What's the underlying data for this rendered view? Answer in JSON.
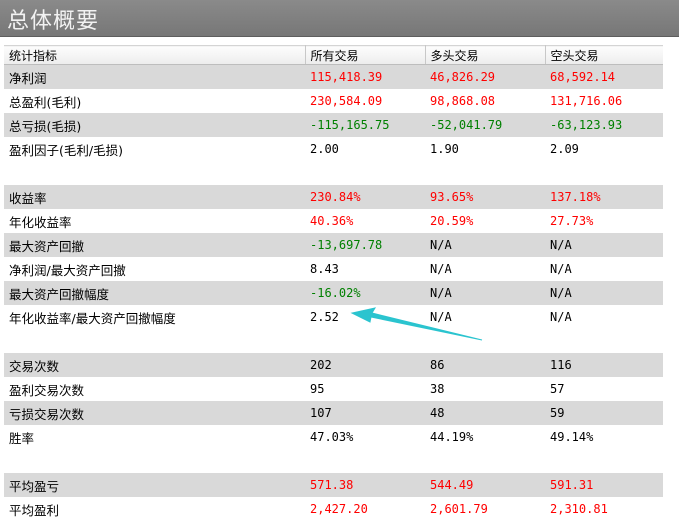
{
  "window": {
    "title": "总体概要"
  },
  "table": {
    "headers": [
      "统计指标",
      "所有交易",
      "多头交易",
      "空头交易"
    ],
    "rows": [
      {
        "label": "净利润",
        "values": [
          "115,418.39",
          "46,826.29",
          "68,592.14"
        ],
        "colors": [
          "red",
          "red",
          "red"
        ],
        "shaded": true
      },
      {
        "label": "总盈利(毛利)",
        "values": [
          "230,584.09",
          "98,868.08",
          "131,716.06"
        ],
        "colors": [
          "red",
          "red",
          "red"
        ],
        "shaded": false
      },
      {
        "label": "总亏损(毛损)",
        "values": [
          "-115,165.75",
          "-52,041.79",
          "-63,123.93"
        ],
        "colors": [
          "green",
          "green",
          "green"
        ],
        "shaded": true
      },
      {
        "label": "盈利因子(毛利/毛损)",
        "values": [
          "2.00",
          "1.90",
          "2.09"
        ],
        "colors": [
          "black",
          "black",
          "black"
        ],
        "shaded": false
      },
      {
        "spacer": true,
        "shaded": false
      },
      {
        "label": "收益率",
        "values": [
          "230.84%",
          "93.65%",
          "137.18%"
        ],
        "colors": [
          "red",
          "red",
          "red"
        ],
        "shaded": true
      },
      {
        "label": "年化收益率",
        "values": [
          "40.36%",
          "20.59%",
          "27.73%"
        ],
        "colors": [
          "red",
          "red",
          "red"
        ],
        "shaded": false
      },
      {
        "label": "最大资产回撤",
        "values": [
          "-13,697.78",
          "N/A",
          "N/A"
        ],
        "colors": [
          "green",
          "black",
          "black"
        ],
        "shaded": true
      },
      {
        "label": "净利润/最大资产回撤",
        "values": [
          "8.43",
          "N/A",
          "N/A"
        ],
        "colors": [
          "black",
          "black",
          "black"
        ],
        "shaded": false
      },
      {
        "label": "最大资产回撤幅度",
        "values": [
          "-16.02%",
          "N/A",
          "N/A"
        ],
        "colors": [
          "green",
          "black",
          "black"
        ],
        "shaded": true
      },
      {
        "label": "年化收益率/最大资产回撤幅度",
        "values": [
          "2.52",
          "N/A",
          "N/A"
        ],
        "colors": [
          "black",
          "black",
          "black"
        ],
        "shaded": false
      },
      {
        "spacer": true,
        "shaded": false
      },
      {
        "label": "交易次数",
        "values": [
          "202",
          "86",
          "116"
        ],
        "colors": [
          "black",
          "black",
          "black"
        ],
        "shaded": true
      },
      {
        "label": "盈利交易次数",
        "values": [
          "95",
          "38",
          "57"
        ],
        "colors": [
          "black",
          "black",
          "black"
        ],
        "shaded": false
      },
      {
        "label": "亏损交易次数",
        "values": [
          "107",
          "48",
          "59"
        ],
        "colors": [
          "black",
          "black",
          "black"
        ],
        "shaded": true
      },
      {
        "label": "胜率",
        "values": [
          "47.03%",
          "44.19%",
          "49.14%"
        ],
        "colors": [
          "black",
          "black",
          "black"
        ],
        "shaded": false
      },
      {
        "spacer": true,
        "shaded": false
      },
      {
        "label": "平均盈亏",
        "values": [
          "571.38",
          "544.49",
          "591.31"
        ],
        "colors": [
          "red",
          "red",
          "red"
        ],
        "shaded": true
      },
      {
        "label": "平均盈利",
        "values": [
          "2,427.20",
          "2,601.79",
          "2,310.81"
        ],
        "colors": [
          "red",
          "red",
          "red"
        ],
        "shaded": false
      }
    ]
  },
  "annotation": {
    "arrow_color": "#2bc4cf"
  }
}
